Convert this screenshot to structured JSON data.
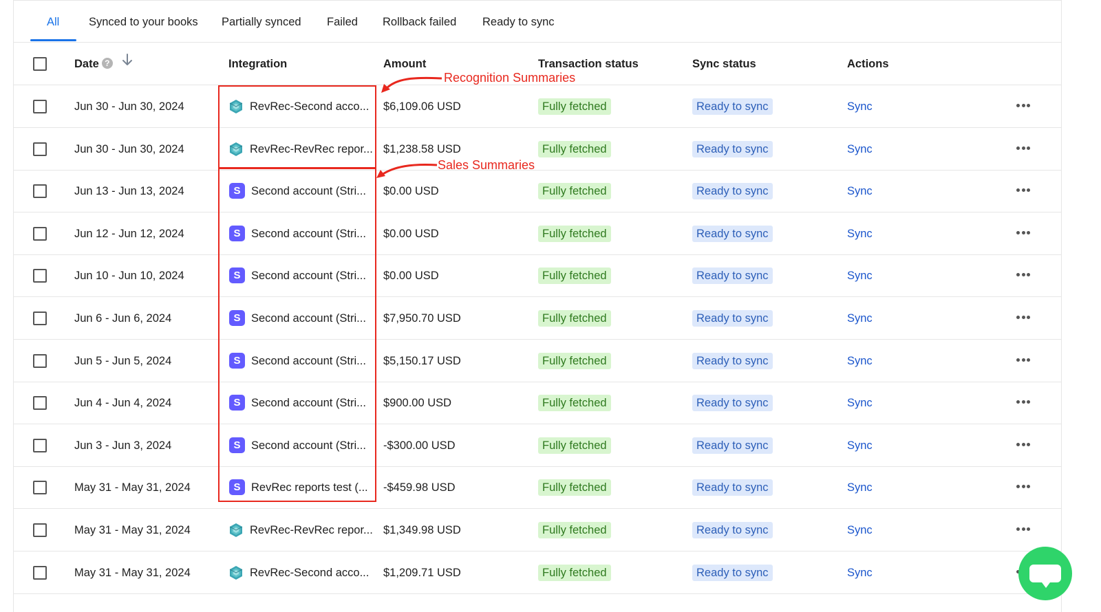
{
  "tabs": [
    {
      "label": "All",
      "active": true
    },
    {
      "label": "Synced to your books"
    },
    {
      "label": "Partially synced"
    },
    {
      "label": "Failed"
    },
    {
      "label": "Rollback failed"
    },
    {
      "label": "Ready to sync"
    }
  ],
  "columns": {
    "date": "Date",
    "integration": "Integration",
    "amount": "Amount",
    "transaction_status": "Transaction status",
    "sync_status": "Sync status",
    "actions": "Actions"
  },
  "help_glyph": "?",
  "rows": [
    {
      "date": "Jun 30 - Jun 30, 2024",
      "icon": "revrec-icon",
      "integration": "RevRec-Second acco...",
      "amount": "$6,109.06 USD",
      "transaction_status": "Fully fetched",
      "sync_status": "Ready to sync",
      "action": "Sync"
    },
    {
      "date": "Jun 30 - Jun 30, 2024",
      "icon": "revrec-icon",
      "integration": "RevRec-RevRec repor...",
      "amount": "$1,238.58 USD",
      "transaction_status": "Fully fetched",
      "sync_status": "Ready to sync",
      "action": "Sync"
    },
    {
      "date": "Jun 13 - Jun 13, 2024",
      "icon": "stripe-icon",
      "integration": "Second account (Stri...",
      "amount": "$0.00 USD",
      "transaction_status": "Fully fetched",
      "sync_status": "Ready to sync",
      "action": "Sync"
    },
    {
      "date": "Jun 12 - Jun 12, 2024",
      "icon": "stripe-icon",
      "integration": "Second account (Stri...",
      "amount": "$0.00 USD",
      "transaction_status": "Fully fetched",
      "sync_status": "Ready to sync",
      "action": "Sync"
    },
    {
      "date": "Jun 10 - Jun 10, 2024",
      "icon": "stripe-icon",
      "integration": "Second account (Stri...",
      "amount": "$0.00 USD",
      "transaction_status": "Fully fetched",
      "sync_status": "Ready to sync",
      "action": "Sync"
    },
    {
      "date": "Jun 6 - Jun 6, 2024",
      "icon": "stripe-icon",
      "integration": "Second account (Stri...",
      "amount": "$7,950.70 USD",
      "transaction_status": "Fully fetched",
      "sync_status": "Ready to sync",
      "action": "Sync"
    },
    {
      "date": "Jun 5 - Jun 5, 2024",
      "icon": "stripe-icon",
      "integration": "Second account (Stri...",
      "amount": "$5,150.17 USD",
      "transaction_status": "Fully fetched",
      "sync_status": "Ready to sync",
      "action": "Sync"
    },
    {
      "date": "Jun 4 - Jun 4, 2024",
      "icon": "stripe-icon",
      "integration": "Second account (Stri...",
      "amount": "$900.00 USD",
      "transaction_status": "Fully fetched",
      "sync_status": "Ready to sync",
      "action": "Sync"
    },
    {
      "date": "Jun 3 - Jun 3, 2024",
      "icon": "stripe-icon",
      "integration": "Second account (Stri...",
      "amount": "-$300.00 USD",
      "transaction_status": "Fully fetched",
      "sync_status": "Ready to sync",
      "action": "Sync"
    },
    {
      "date": "May 31 - May 31, 2024",
      "icon": "stripe-icon",
      "integration": "RevRec reports test (...",
      "amount": "-$459.98 USD",
      "transaction_status": "Fully fetched",
      "sync_status": "Ready to sync",
      "action": "Sync"
    },
    {
      "date": "May 31 - May 31, 2024",
      "icon": "revrec-icon",
      "integration": "RevRec-RevRec repor...",
      "amount": "$1,349.98 USD",
      "transaction_status": "Fully fetched",
      "sync_status": "Ready to sync",
      "action": "Sync"
    },
    {
      "date": "May 31 - May 31, 2024",
      "icon": "revrec-icon",
      "integration": "RevRec-Second acco...",
      "amount": "$1,209.71 USD",
      "transaction_status": "Fully fetched",
      "sync_status": "Ready to sync",
      "action": "Sync"
    }
  ],
  "stripe_glyph": "S",
  "annotations": {
    "recognition": "Recognition Summaries",
    "sales": "Sales Summaries"
  },
  "colors": {
    "accent": "#1a73e8",
    "annotation": "#e8281e",
    "fetched_bg": "#d8f5cf",
    "sync_bg": "#dde8fb",
    "stripe": "#635bff",
    "chat": "#2fd46a"
  }
}
